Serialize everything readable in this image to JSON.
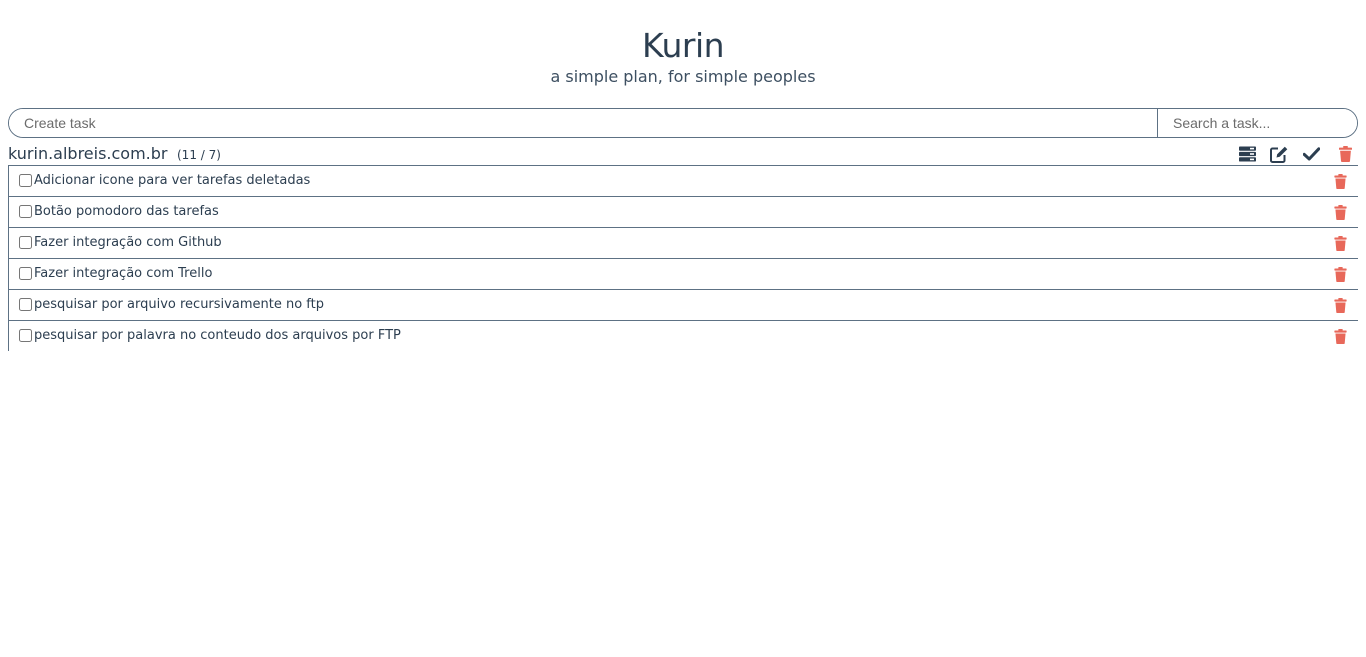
{
  "app": {
    "title": "Kurin",
    "subtitle": "a simple plan, for simple peoples"
  },
  "inputs": {
    "create_placeholder": "Create task",
    "search_placeholder": "Search a task..."
  },
  "project": {
    "name": "kurin.albreis.com.br",
    "count": "(11 / 7)",
    "actions": [
      "list-icon",
      "edit-icon",
      "check-icon",
      "trash-icon"
    ]
  },
  "tasks": [
    {
      "label": "Adicionar icone para ver tarefas deletadas",
      "checked": false
    },
    {
      "label": "Botão pomodoro das tarefas",
      "checked": false
    },
    {
      "label": "Fazer integração com Github",
      "checked": false
    },
    {
      "label": "Fazer integração com Trello",
      "checked": false
    },
    {
      "label": "pesquisar por arquivo recursivamente no ftp",
      "checked": false
    },
    {
      "label": "pesquisar por palavra no conteudo dos arquivos por FTP",
      "checked": false
    }
  ],
  "colors": {
    "text": "#2c3e50",
    "border": "#5d7184",
    "delete": "#e8685a"
  }
}
